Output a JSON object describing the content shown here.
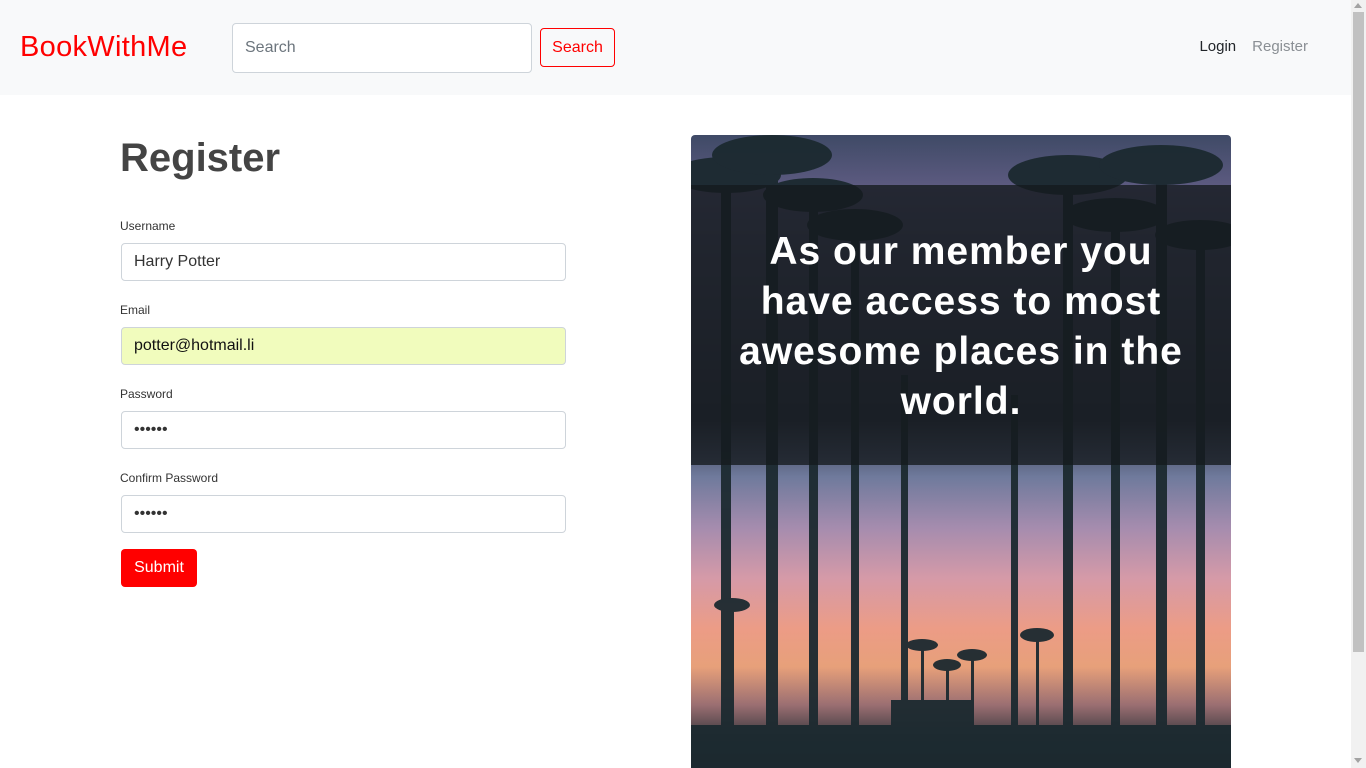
{
  "header": {
    "brand": "BookWithMe",
    "search_placeholder": "Search",
    "search_button": "Search",
    "nav": {
      "login": "Login",
      "register": "Register"
    }
  },
  "form": {
    "title": "Register",
    "fields": {
      "username": {
        "label": "Username",
        "value": "Harry Potter"
      },
      "email": {
        "label": "Email",
        "value": "potter@hotmail.li"
      },
      "password": {
        "label": "Password",
        "value": "••••••"
      },
      "confirm_password": {
        "label": "Confirm Password",
        "value": "••••••"
      }
    },
    "submit": "Submit"
  },
  "promo": {
    "text": "As our member you have access to most awesome places in the world."
  },
  "colors": {
    "brand": "#ff0000",
    "autofill_bg": "#f1fcbd",
    "heading": "#444444"
  }
}
